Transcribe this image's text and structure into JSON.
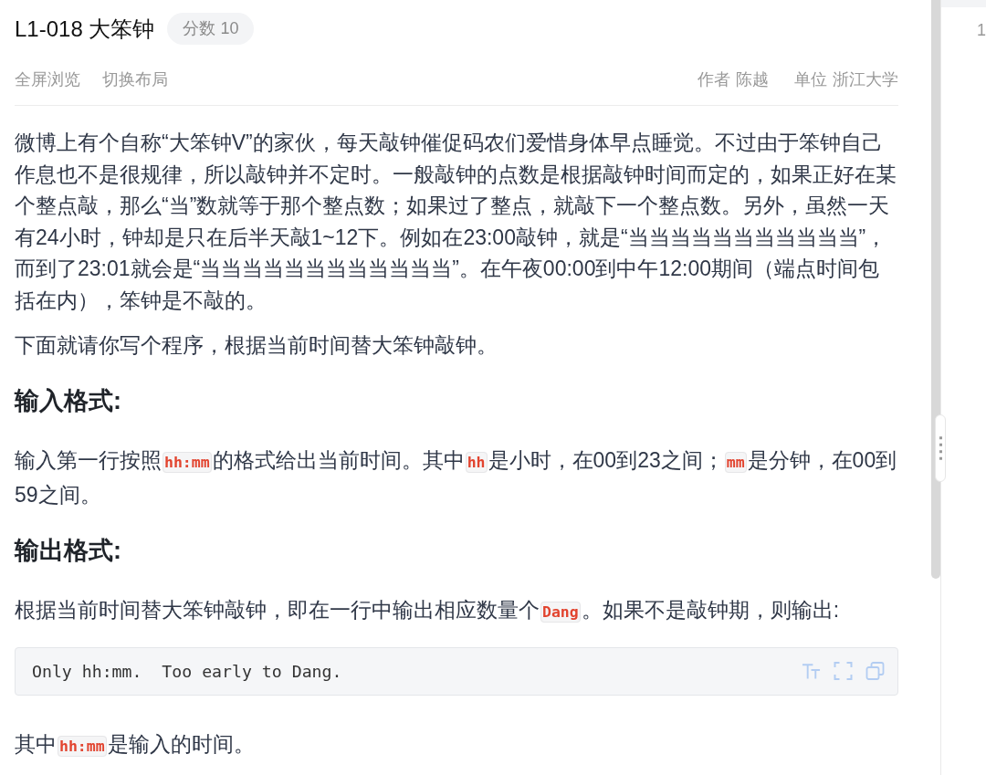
{
  "problem": {
    "title": "L1-018 大笨钟",
    "score_badge": "分数 10"
  },
  "toolbar": {
    "actions": [
      "全屏浏览",
      "切换布局"
    ],
    "meta": [
      {
        "label": "作者",
        "value": "陈越"
      },
      {
        "label": "单位",
        "value": "浙江大学"
      }
    ]
  },
  "content": [
    {
      "kind": "paragraph",
      "parts": [
        {
          "kind": "text",
          "text": "微博上有个自称“大笨钟V”的家伙，每天敲钟催促码农们爱惜身体早点睡觉。不过由于笨钟自己作息也不是很规律，所以敲钟并不定时。一般敲钟的点数是根据敲钟时间而定的，如果正好在某个整点敲，那么“当”数就等于那个整点数；如果过了整点，就敲下一个整点数。另外，虽然一天有24小时，钟却是只在后半天敲1~12下。例如在23:00敲钟，就是“当当当当当当当当当当当”，而到了23:01就会是“当当当当当当当当当当当当”。在午夜00:00到中午12:00期间（端点时间包括在内），笨钟是不敲的。"
        }
      ]
    },
    {
      "kind": "paragraph",
      "parts": [
        {
          "kind": "text",
          "text": "下面就请你写个程序，根据当前时间替大笨钟敲钟。"
        }
      ]
    },
    {
      "kind": "heading",
      "text": "输入格式:"
    },
    {
      "kind": "paragraph",
      "parts": [
        {
          "kind": "text",
          "text": "输入第一行按照"
        },
        {
          "kind": "code",
          "text": "hh:mm"
        },
        {
          "kind": "text",
          "text": "的格式给出当前时间。其中"
        },
        {
          "kind": "code",
          "text": "hh"
        },
        {
          "kind": "text",
          "text": "是小时，在00到23之间；"
        },
        {
          "kind": "code",
          "text": "mm"
        },
        {
          "kind": "text",
          "text": "是分钟，在00到59之间。"
        }
      ]
    },
    {
      "kind": "heading",
      "text": "输出格式:"
    },
    {
      "kind": "paragraph",
      "parts": [
        {
          "kind": "text",
          "text": "根据当前时间替大笨钟敲钟，即在一行中输出相应数量个"
        },
        {
          "kind": "code",
          "text": "Dang"
        },
        {
          "kind": "text",
          "text": "。如果不是敲钟期，则输出:"
        }
      ]
    },
    {
      "kind": "code_block",
      "text": "Only hh:mm.  Too early to Dang."
    },
    {
      "kind": "paragraph",
      "parts": [
        {
          "kind": "text",
          "text": "其中"
        },
        {
          "kind": "code",
          "text": "hh:mm"
        },
        {
          "kind": "text",
          "text": "是输入的时间。"
        }
      ]
    }
  ],
  "editor": {
    "line_numbers": [
      "1"
    ]
  }
}
